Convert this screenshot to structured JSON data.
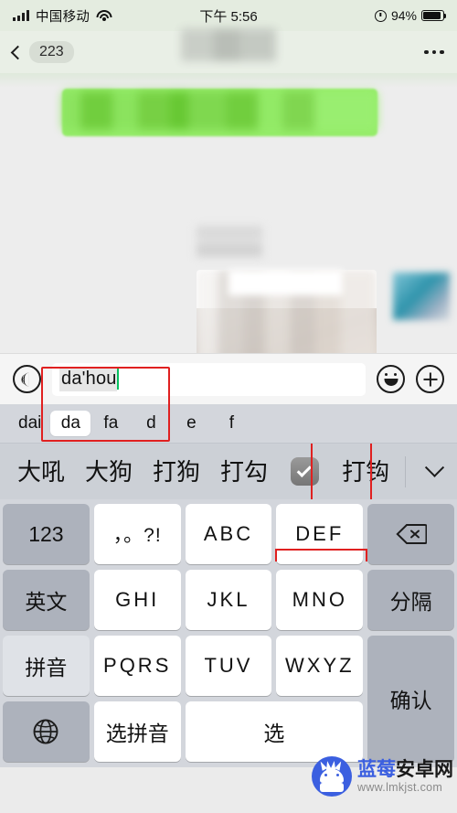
{
  "status_bar": {
    "carrier": "中国移动",
    "time": "下午 5:56",
    "battery_percent": "94%",
    "signal_icon": "signal-bars-icon",
    "wifi_icon": "wifi-icon",
    "alarm_icon": "alarm-clock-icon",
    "battery_icon": "battery-icon"
  },
  "nav_bar": {
    "back_icon": "chevron-left-icon",
    "unread_count": "223",
    "title": "",
    "more_icon": "more-dots-icon"
  },
  "chat": {
    "messages": [
      {
        "type": "text-bubble",
        "side": "right",
        "content": "",
        "blurred": true
      },
      {
        "type": "timestamp",
        "content": "",
        "blurred": true
      },
      {
        "type": "image-bubble",
        "side": "right",
        "content": "",
        "blurred": true
      }
    ]
  },
  "annotations": {
    "arrow_color": "#e02020",
    "box_color": "#e02020",
    "input_highlight": "red-box-around-input",
    "candidate_highlight": "red-box-around-checkmark-candidate"
  },
  "input_bar": {
    "voice_icon": "voice-input-icon",
    "composed_text": "da'hou",
    "placeholder": "",
    "caret_color": "#07c160",
    "emoji_icon": "emoji-smiley-icon",
    "plus_icon": "plus-circle-icon"
  },
  "keyboard": {
    "pinyin_segments": [
      {
        "label": "dai",
        "selected": false
      },
      {
        "label": "da",
        "selected": true
      },
      {
        "label": "fa",
        "selected": false
      },
      {
        "label": "d",
        "selected": false
      },
      {
        "label": "e",
        "selected": false
      },
      {
        "label": "f",
        "selected": false
      }
    ],
    "candidates": [
      {
        "label": "大吼",
        "type": "text"
      },
      {
        "label": "大狗",
        "type": "text"
      },
      {
        "label": "打狗",
        "type": "text"
      },
      {
        "label": "打勾",
        "type": "text"
      },
      {
        "label": "",
        "type": "emoji",
        "icon": "checkmark-box-emoji",
        "highlighted": true
      },
      {
        "label": "打钩",
        "type": "text",
        "clipped": true
      }
    ],
    "expand_icon": "chevron-down-icon",
    "rows": [
      [
        {
          "label": "123",
          "style": "fn",
          "name": "key-123"
        },
        {
          "label": "，。?!",
          "style": "light",
          "name": "key-punctuation"
        },
        {
          "label": "ABC",
          "style": "light",
          "name": "key-abc"
        },
        {
          "label": "DEF",
          "style": "light",
          "name": "key-def"
        },
        {
          "label": "",
          "style": "fn",
          "name": "key-backspace",
          "icon": "backspace-icon"
        }
      ],
      [
        {
          "label": "英文",
          "style": "fn",
          "name": "key-english"
        },
        {
          "label": "GHI",
          "style": "light",
          "name": "key-ghi"
        },
        {
          "label": "JKL",
          "style": "light",
          "name": "key-jkl"
        },
        {
          "label": "MNO",
          "style": "light",
          "name": "key-mno"
        },
        {
          "label": "分隔",
          "style": "fn",
          "name": "key-separator"
        }
      ],
      [
        {
          "label": "拼音",
          "style": "fn-soft",
          "name": "key-pinyin"
        },
        {
          "label": "PQRS",
          "style": "light",
          "name": "key-pqrs"
        },
        {
          "label": "TUV",
          "style": "light",
          "name": "key-tuv"
        },
        {
          "label": "WXYZ",
          "style": "light",
          "name": "key-wxyz"
        },
        {
          "label": "确认",
          "style": "fn",
          "name": "key-confirm",
          "span_rows": 2
        }
      ],
      [
        {
          "label": "",
          "style": "fn",
          "name": "key-globe",
          "icon": "globe-icon"
        },
        {
          "label": "选拼音",
          "style": "light",
          "name": "key-select-pinyin"
        },
        {
          "label": "选",
          "style": "light",
          "name": "key-select",
          "span_cols": 2
        }
      ]
    ]
  },
  "watermark": {
    "brand_blue": "蓝莓",
    "brand_dark": "安卓网",
    "url": "www.lmkjst.com",
    "logo_icon": "android-robot-logo",
    "brand_color": "#3b5fe0"
  }
}
